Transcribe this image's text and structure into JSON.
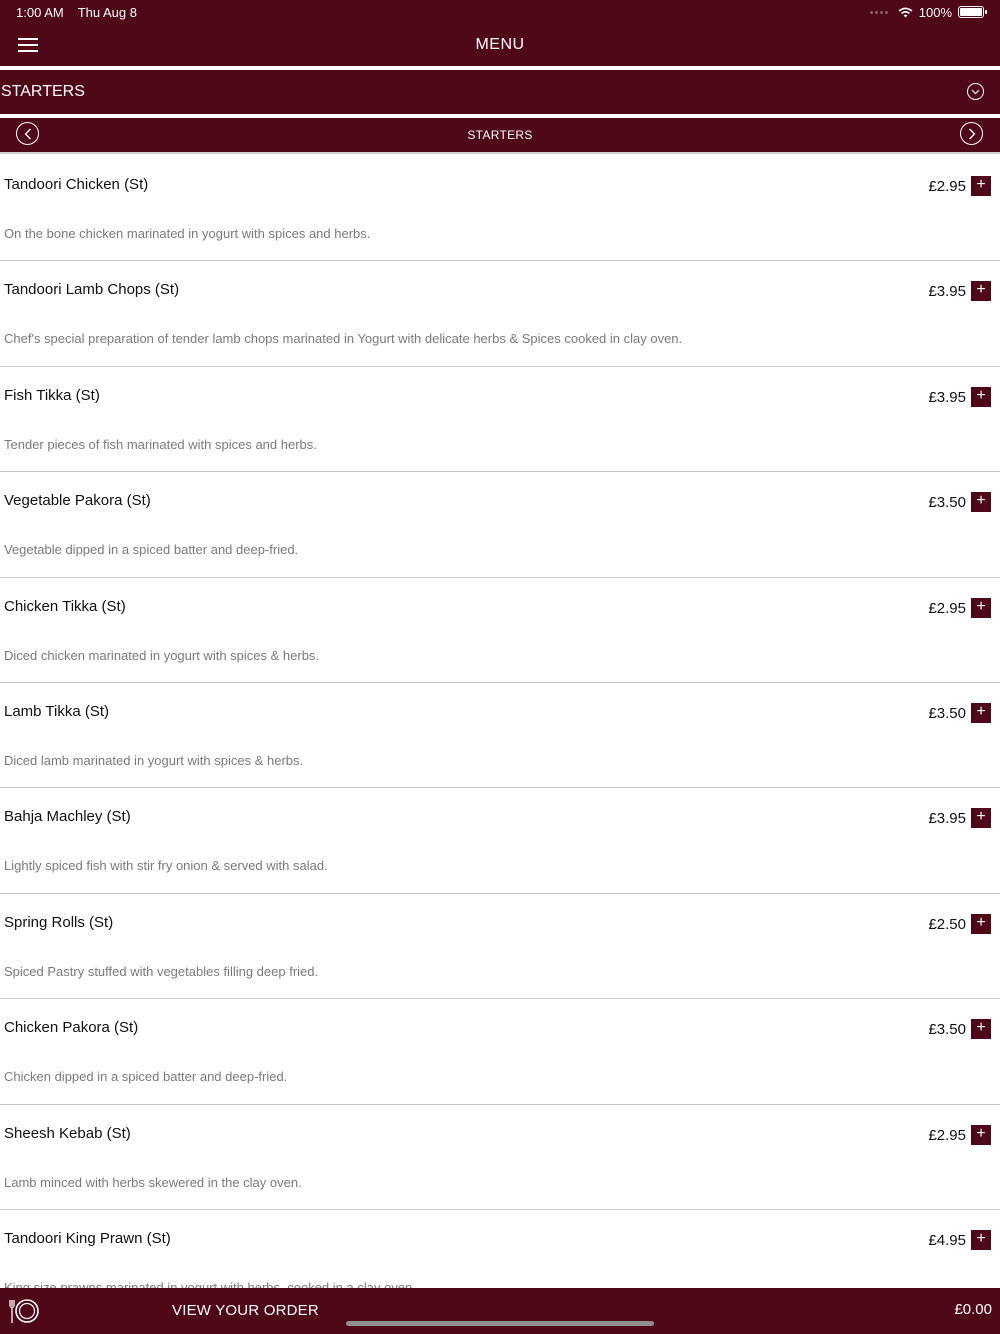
{
  "status": {
    "time": "1:00 AM",
    "date": "Thu Aug 8",
    "battery": "100%"
  },
  "header": {
    "title": "MENU"
  },
  "category": {
    "selected": "STARTERS"
  },
  "subheader": {
    "title": "STARTERS"
  },
  "items": [
    {
      "name": "Tandoori Chicken (St)",
      "price": "£2.95",
      "desc": "On the bone chicken marinated in yogurt with spices and herbs."
    },
    {
      "name": "Tandoori Lamb Chops (St)",
      "price": "£3.95",
      "desc": "Chef's special preparation of tender lamb chops marinated  in Yogurt with delicate herbs & Spices cooked in clay oven."
    },
    {
      "name": "Fish Tikka (St)",
      "price": "£3.95",
      "desc": "Tender pieces of fish marinated with spices and herbs."
    },
    {
      "name": "Vegetable Pakora (St)",
      "price": "£3.50",
      "desc": "Vegetable dipped in a spiced batter and deep-fried."
    },
    {
      "name": "Chicken Tikka (St)",
      "price": "£2.95",
      "desc": "Diced chicken marinated in yogurt with spices & herbs."
    },
    {
      "name": "Lamb Tikka (St)",
      "price": "£3.50",
      "desc": "Diced lamb marinated in yogurt with spices & herbs."
    },
    {
      "name": "Bahja Machley (St)",
      "price": "£3.95",
      "desc": "Lightly spiced fish with stir fry onion & served with  salad."
    },
    {
      "name": "Spring Rolls (St)",
      "price": "£2.50",
      "desc": "Spiced Pastry stuffed with vegetables filling deep fried."
    },
    {
      "name": "Chicken Pakora (St)",
      "price": "£3.50",
      "desc": "Chicken dipped in a spiced batter and deep-fried."
    },
    {
      "name": "Sheesh Kebab (St)",
      "price": "£2.95",
      "desc": "Lamb minced with herbs skewered in the clay oven."
    },
    {
      "name": "Tandoori King Prawn (St)",
      "price": "£4.95",
      "desc": "King size prawns marinated in yogurt with herbs, cooked in a clay oven."
    }
  ],
  "add_label": "+",
  "footer": {
    "view_order": "VIEW YOUR ORDER",
    "total": "£0.00"
  },
  "colors": {
    "brand": "#4e0818"
  },
  "icons": {
    "menu": "hamburger-icon",
    "dropdown": "chevron-down-circle-icon",
    "prev": "chevron-left-circle-icon",
    "next": "chevron-right-circle-icon",
    "order": "plate-cutlery-icon",
    "wifi": "wifi-icon",
    "battery": "battery-icon"
  }
}
